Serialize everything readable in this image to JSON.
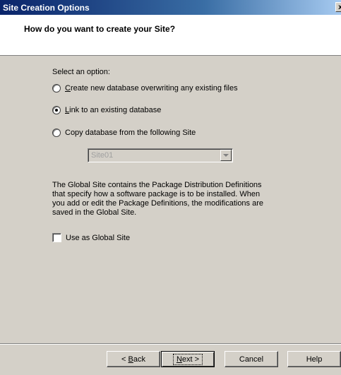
{
  "window": {
    "title": "Site Creation Options",
    "close_glyph": "x"
  },
  "header": {
    "question": "How do you want to create your Site?"
  },
  "options": {
    "prompt": "Select an option:",
    "items": [
      {
        "hotkey": "C",
        "rest": "reate new database overwriting any existing files",
        "checked": false
      },
      {
        "hotkey": "L",
        "rest": "ink to an existing database",
        "checked": true
      },
      {
        "hotkey": "",
        "rest": "Copy database from the following Site",
        "checked": false
      }
    ]
  },
  "site_select": {
    "value": "Site01",
    "disabled": true
  },
  "global_site": {
    "description_lines": [
      "The Global Site contains the Package Distribution Definitions",
      "that specify how a software package is to be installed. When",
      "you add or edit the Package Definitions, the modifications are",
      "saved in the Global Site."
    ],
    "checkbox_label": "Use as Global Site",
    "checked": false
  },
  "buttons": {
    "back": {
      "prefix": "< ",
      "hotkey": "B",
      "rest": "ack"
    },
    "next": {
      "hotkey": "N",
      "rest": "ext >"
    },
    "cancel": "Cancel",
    "help": "Help"
  }
}
